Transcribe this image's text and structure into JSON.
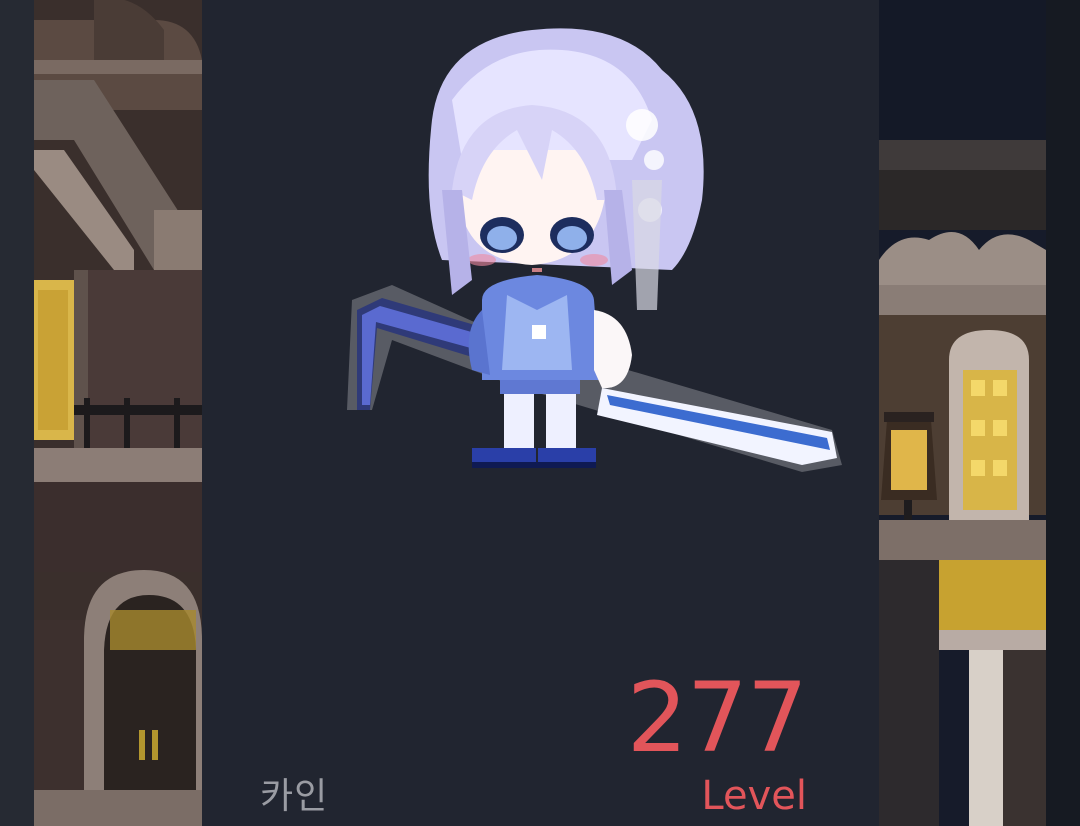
{
  "profile": {
    "job": "카인",
    "level": "277",
    "level_label": "Level"
  },
  "colors": {
    "card_bg": "#212530",
    "accent": "#e2555a",
    "job_text": "#9a9ca3"
  },
  "icons": {
    "character": "character-avatar-sprite"
  }
}
